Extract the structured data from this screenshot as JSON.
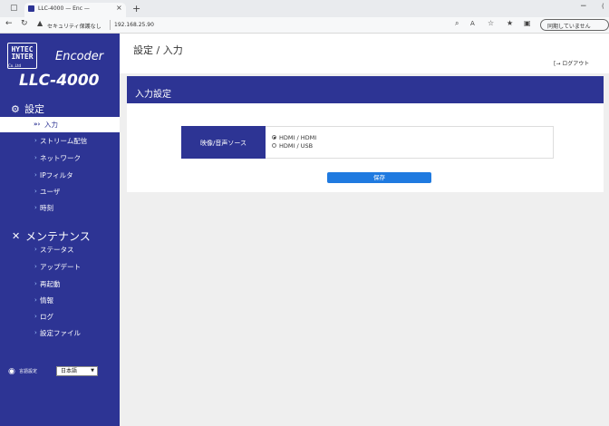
{
  "browser": {
    "tab_title": "LLC-4000 — Enc —",
    "security_text": "セキュリティ保護なし",
    "url": "192.168.25.90",
    "sync_button": "同期していません"
  },
  "brand": {
    "logo_text_line1": "HYTEC",
    "logo_text_line2": "INTER",
    "logo_sub": "Co.,Ltd",
    "product": "Encoder",
    "model": "LLC-4000"
  },
  "sidebar": {
    "settings_title": "設定",
    "settings_items": [
      {
        "label": "入力",
        "active": true
      },
      {
        "label": "ストリーム配信"
      },
      {
        "label": "ネットワーク"
      },
      {
        "label": "IPフィルタ"
      },
      {
        "label": "ユーザ"
      },
      {
        "label": "時刻"
      }
    ],
    "maintenance_title": "メンテナンス",
    "maintenance_items": [
      {
        "label": "ステータス"
      },
      {
        "label": "アップデート"
      },
      {
        "label": "再起動"
      },
      {
        "label": "情報"
      },
      {
        "label": "ログ"
      },
      {
        "label": "設定ファイル"
      }
    ],
    "language_label": "言語設定",
    "language_value": "日本語"
  },
  "header": {
    "title": "設定 / 入力",
    "logout": "ログアウト"
  },
  "panel": {
    "title": "入力設定",
    "field_label": "映像/音声ソース",
    "options": [
      {
        "label": "HDMI / HDMI",
        "selected": true
      },
      {
        "label": "HDMI / USB",
        "selected": false
      }
    ],
    "save_label": "保存"
  },
  "colors": {
    "brand_navy": "#2d3494",
    "button_blue": "#1f7ae0",
    "background_gray": "#efefef"
  }
}
